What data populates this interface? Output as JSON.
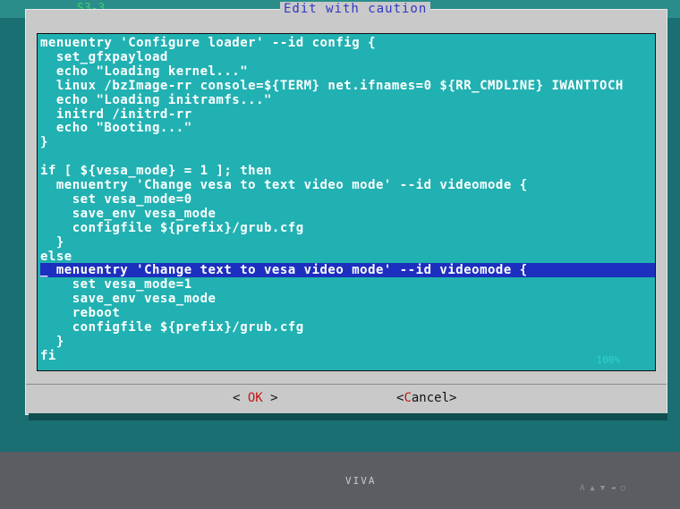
{
  "screen": {
    "corner_text": "S3-3"
  },
  "dialog": {
    "title": "Edit with caution",
    "lines": [
      "menuentry 'Configure loader' --id config {",
      "  set_gfxpayload",
      "  echo \"Loading kernel...\"",
      "  linux /bzImage-rr console=${TERM} net.ifnames=0 ${RR_CMDLINE} IWANTTOCH",
      "  echo \"Loading initramfs...\"",
      "  initrd /initrd-rr",
      "  echo \"Booting...\"",
      "}",
      "",
      "if [ ${vesa_mode} = 1 ]; then",
      "  menuentry 'Change vesa to text video mode' --id videomode {",
      "    set vesa_mode=0",
      "    save_env vesa_mode",
      "    configfile ${prefix}/grub.cfg",
      "  }",
      "else",
      "_ menuentry 'Change text to vesa video mode' --id videomode {",
      "    set vesa_mode=1",
      "    save_env vesa_mode",
      "    reboot",
      "    configfile ${prefix}/grub.cfg",
      "  }",
      "fi"
    ],
    "selected_line": 16,
    "scroll_percent": "100%",
    "ok_label": "OK",
    "cancel_label": "Cancel"
  },
  "monitor": {
    "logo": "VIVA",
    "buttons": "A▲▼◄◯"
  },
  "colors": {
    "editor_bg": "#21b1b2",
    "selection": "#1d2fbf",
    "title": "#2f38c4",
    "hotkey": "#c21616"
  }
}
